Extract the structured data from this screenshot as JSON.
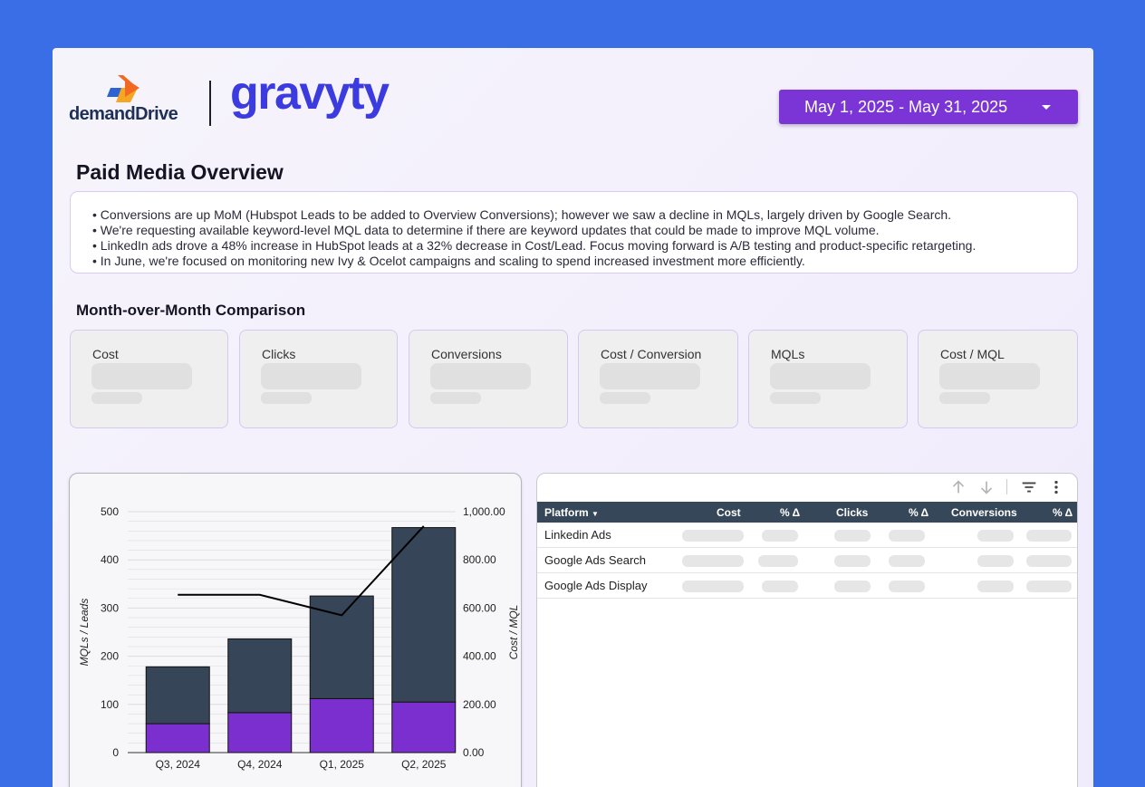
{
  "header": {
    "logo_left_text": "demandDrive",
    "logo_right_text": "gravyty",
    "date_range": "May 1, 2025 - May 31, 2025"
  },
  "overview": {
    "title": "Paid Media Overview",
    "bullets": [
      "• Conversions are up MoM (Hubspot Leads to be added to Overview Conversions); however we saw a decline in MQLs, largely driven by Google Search.",
      "• We're requesting available keyword-level MQL data to determine if there are keyword updates that could be made to improve MQL volume.",
      "• LinkedIn ads drove a 48% increase in HubSpot leads at a 32% decrease in Cost/Lead. Focus moving forward is A/B testing and product-specific retargeting.",
      "• In June, we're focused on monitoring new Ivy & Ocelot campaigns and scaling to spend increased investment more efficiently."
    ]
  },
  "comparison": {
    "title": "Month-over-Month Comparison",
    "cards": [
      {
        "label": "Cost"
      },
      {
        "label": "Clicks"
      },
      {
        "label": "Conversions"
      },
      {
        "label": "Cost / Conversion"
      },
      {
        "label": "MQLs"
      },
      {
        "label": "Cost / MQL"
      }
    ]
  },
  "chart_data": {
    "type": "bar",
    "stacked": true,
    "categories": [
      "Q3, 2024",
      "Q4, 2024",
      "Q1, 2025",
      "Q2, 2025"
    ],
    "series": [
      {
        "kind": "bar",
        "color": "#7b2fcf",
        "values": [
          60,
          83,
          112,
          105
        ]
      },
      {
        "kind": "bar",
        "color": "#374558",
        "values": [
          118,
          153,
          213,
          362
        ]
      },
      {
        "kind": "line",
        "axis": "right",
        "color": "#000000",
        "values": [
          655,
          655,
          570,
          940
        ]
      }
    ],
    "ylabel": "MQLs / Leads",
    "y2label": "Cost / MQL",
    "ylim": [
      0,
      500
    ],
    "y2lim": [
      0,
      1000
    ],
    "yticks": [
      "0",
      "100",
      "200",
      "300",
      "400",
      "500"
    ],
    "y2ticks": [
      "0.00",
      "200.00",
      "400.00",
      "600.00",
      "800.00",
      "1,000.00"
    ],
    "grid": true
  },
  "table": {
    "columns": [
      "Platform",
      "Cost",
      "% Δ",
      "Clicks",
      "% Δ",
      "Conversions",
      "% Δ"
    ],
    "rows": [
      {
        "platform": "Linkedin Ads"
      },
      {
        "platform": "Google Ads Search"
      },
      {
        "platform": "Google Ads Display"
      }
    ],
    "icons": [
      "arrow-up-icon",
      "arrow-down-icon",
      "filter-icon",
      "more-vert-icon"
    ]
  }
}
